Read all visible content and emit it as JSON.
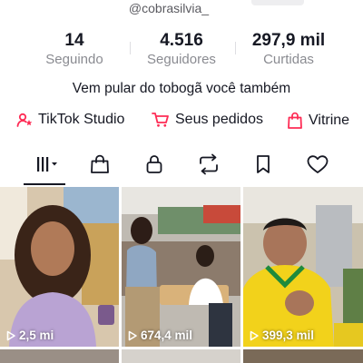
{
  "profile": {
    "username": "@cobrasilvia_",
    "bio": "Vem pular do tobogã você também"
  },
  "stats": {
    "following": {
      "value": "14",
      "label": "Seguindo"
    },
    "followers": {
      "value": "4.516",
      "label": "Seguidores"
    },
    "likes": {
      "value": "297,9 mil",
      "label": "Curtidas"
    }
  },
  "links": [
    {
      "label": "TikTok Studio",
      "icon": "tiktok-studio-icon",
      "color": "#fe2c55"
    },
    {
      "label": "Seus pedidos",
      "icon": "cart-icon",
      "color": "#fe2c55"
    },
    {
      "label": "Vitrine",
      "icon": "shopping-bag-icon",
      "color": "#fe2c55"
    }
  ],
  "tabs": [
    {
      "icon": "videos-grid-icon",
      "active": true
    },
    {
      "icon": "shop-bag-icon"
    },
    {
      "icon": "lock-icon"
    },
    {
      "icon": "repost-icon"
    },
    {
      "icon": "bookmark-icon"
    },
    {
      "icon": "heart-icon"
    }
  ],
  "videos": [
    {
      "views": "2,5 mi"
    },
    {
      "views": "674,4 mil"
    },
    {
      "views": "399,3 mil"
    }
  ]
}
